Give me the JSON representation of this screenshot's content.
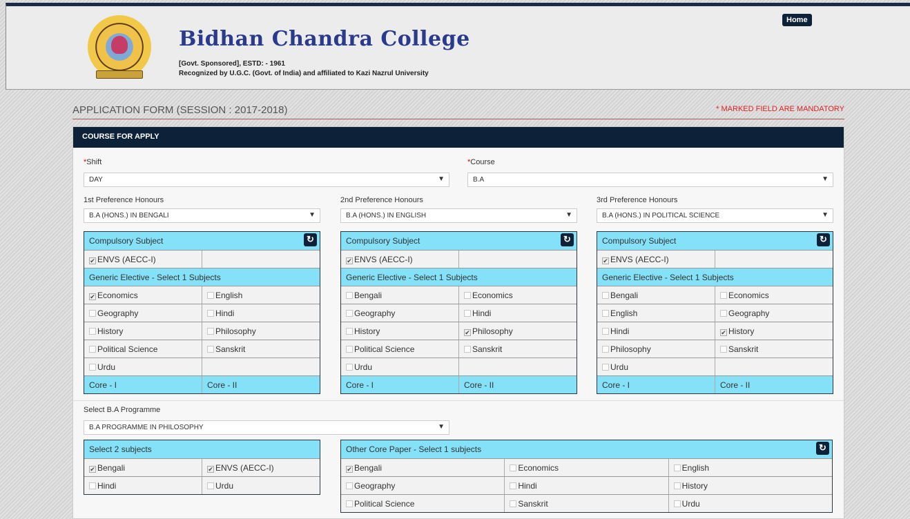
{
  "header": {
    "college_name": "Bidhan Chandra College",
    "line1": "[Govt. Sponsored], ESTD: - 1961",
    "line2": "Recognized by U.G.C. (Govt. of India) and affiliated to Kazi Nazrul University",
    "home": "Home"
  },
  "form": {
    "title": "APPLICATION FORM (SESSION : 2017-2018)",
    "mandatory": "* MARKED FIELD ARE MANDATORY",
    "panel_title": "COURSE FOR APPLY"
  },
  "shift": {
    "label": "Shift",
    "value": "DAY"
  },
  "course": {
    "label": "Course",
    "value": "B.A"
  },
  "prefs": [
    {
      "label": "1st Preference Honours",
      "value": "B.A (HONS.) IN BENGALI"
    },
    {
      "label": "2nd Preference Honours",
      "value": "B.A (HONS.) IN ENGLISH"
    },
    {
      "label": "3rd Preference Honours",
      "value": "B.A (HONS.) IN POLITICAL SCIENCE"
    }
  ],
  "tables": [
    {
      "compulsory": "Compulsory Subject",
      "envs": "ENVS (AECC-I)",
      "ge_title": "Generic Elective - Select 1 Subjects",
      "rows": [
        [
          "Economics",
          "English"
        ],
        [
          "Geography",
          "Hindi"
        ],
        [
          "History",
          "Philosophy"
        ],
        [
          "Political Science",
          "Sanskrit"
        ],
        [
          "Urdu",
          ""
        ]
      ],
      "checked": "Economics",
      "core1": "Core - I",
      "core2": "Core - II"
    },
    {
      "compulsory": "Compulsory Subject",
      "envs": "ENVS (AECC-I)",
      "ge_title": "Generic Elective - Select 1 Subjects",
      "rows": [
        [
          "Bengali",
          "Economics"
        ],
        [
          "Geography",
          "Hindi"
        ],
        [
          "History",
          "Philosophy"
        ],
        [
          "Political Science",
          "Sanskrit"
        ],
        [
          "Urdu",
          ""
        ]
      ],
      "checked": "Philosophy",
      "core1": "Core - I",
      "core2": "Core - II"
    },
    {
      "compulsory": "Compulsory Subject",
      "envs": "ENVS (AECC-I)",
      "ge_title": "Generic Elective - Select 1 Subjects",
      "rows": [
        [
          "Bengali",
          "Economics"
        ],
        [
          "English",
          "Geography"
        ],
        [
          "Hindi",
          "History"
        ],
        [
          "Philosophy",
          "Sanskrit"
        ],
        [
          "Urdu",
          ""
        ]
      ],
      "checked": "History",
      "core1": "Core - I",
      "core2": "Core - II"
    }
  ],
  "programme": {
    "label": "Select B.A Programme",
    "value": "B.A PROGRAMME IN PHILOSOPHY"
  },
  "select2": {
    "title": "Select 2 subjects",
    "rows": [
      [
        "Bengali",
        "ENVS (AECC-I)"
      ],
      [
        "Hindi",
        "Urdu"
      ]
    ],
    "checked": [
      "Bengali",
      "ENVS (AECC-I)"
    ]
  },
  "other_core": {
    "title": "Other Core Paper - Select 1 subjects",
    "rows": [
      [
        "Bengali",
        "Economics",
        "English"
      ],
      [
        "Geography",
        "Hindi",
        "History"
      ],
      [
        "Political Science",
        "Sanskrit",
        "Urdu"
      ]
    ],
    "checked": [
      "Bengali"
    ]
  },
  "icons": {
    "refresh": "refresh-icon",
    "dropdown": "caret-down-icon"
  }
}
